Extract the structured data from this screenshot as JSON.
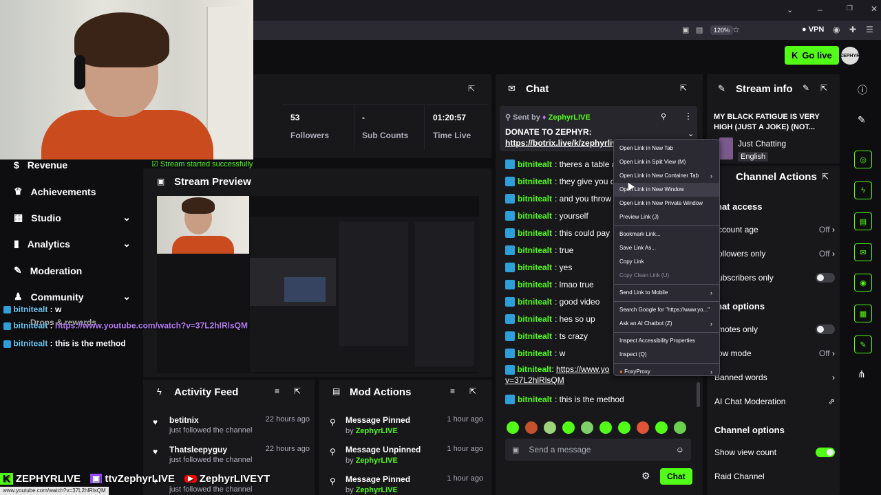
{
  "browser": {
    "zoom": "120%",
    "vpn_label": "VPN"
  },
  "header": {
    "go_live": "Go live",
    "avatar_text": "ZEPHYR"
  },
  "stats": {
    "followers_value": "53",
    "followers_label": "Followers",
    "subs_value": "-",
    "subs_label": "Sub Counts",
    "time_value": "01:20:57",
    "time_label": "Time Live"
  },
  "toast": "Stream started successfully",
  "sidebar": {
    "items": [
      {
        "label": "Revenue"
      },
      {
        "label": "Achievements"
      },
      {
        "label": "Studio"
      },
      {
        "label": "Analytics"
      },
      {
        "label": "Moderation"
      },
      {
        "label": "Community"
      },
      {
        "label": "Drops & rewards"
      }
    ]
  },
  "preview": {
    "title": "Stream Preview"
  },
  "overlay": {
    "chat": [
      {
        "user": "bitnitealt",
        "sep": " : ",
        "msg": "w"
      },
      {
        "user": "bitnitealt",
        "sep": " : ",
        "msg": "https://www.youtube.com/watch?v=37L2hlRlsQM"
      },
      {
        "user": "bitnitealt",
        "sep": " : ",
        "msg": "this is the method"
      }
    ],
    "banner": {
      "kick": "ZEPHYRLIVE",
      "twitch": "ttvZephyrLIVE",
      "youtube": "ZephyrLIVEYT"
    },
    "status_url": "www.youtube.com/watch?v=37L2hlRlsQM"
  },
  "chat": {
    "title": "Chat",
    "pinned": {
      "sent_by": "Sent by",
      "user": "ZephyrLIVE",
      "text": "DONATE TO ZEPHYR: ",
      "link": "https://botrix.live/k/zephyrlive/tip"
    },
    "messages": [
      {
        "user": "bitnitealt",
        "msg": ": theres a table a"
      },
      {
        "user": "bitnitealt",
        "msg": ": they give you d"
      },
      {
        "user": "bitnitealt",
        "msg": ": and you throw t"
      },
      {
        "user": "bitnitealt",
        "msg": ": yourself"
      },
      {
        "user": "bitnitealt",
        "msg": ": this could pay"
      },
      {
        "user": "bitnitealt",
        "msg": ": true"
      },
      {
        "user": "bitnitealt",
        "msg": ": yes"
      },
      {
        "user": "bitnitealt",
        "msg": ": lmao true"
      },
      {
        "user": "bitnitealt",
        "msg": ": good video"
      },
      {
        "user": "bitnitealt",
        "msg": ": hes so up"
      },
      {
        "user": "bitnitealt",
        "msg": ": ts crazy"
      },
      {
        "user": "bitnitealt",
        "msg": ": w"
      }
    ],
    "link_msg": {
      "user": "bitnitealt",
      "sep": ": ",
      "link": "https://www.yo",
      "link2": "v=37L2hlRlsQM"
    },
    "last_msg": {
      "user": "bitnitealt",
      "msg": ": this is the method"
    },
    "input_placeholder": "Send a message",
    "send_label": "Chat"
  },
  "context_menu": {
    "items": [
      {
        "label": "Open Link in New Tab",
        "arrow": ""
      },
      {
        "label": "Open Link in Split View (M)",
        "arrow": ""
      },
      {
        "label": "Open Link in New Container Tab",
        "arrow": "›"
      },
      {
        "label": "Open Link in New Window",
        "arrow": ""
      },
      {
        "label": "Open Link in New Private Window",
        "arrow": ""
      },
      {
        "label": "Preview Link (J)",
        "arrow": ""
      },
      {
        "label": "Bookmark Link...",
        "arrow": ""
      },
      {
        "label": "Save Link As...",
        "arrow": ""
      },
      {
        "label": "Copy Link",
        "arrow": ""
      },
      {
        "label": "Copy Clean Link (U)",
        "arrow": ""
      },
      {
        "label": "Send Link to Mobile",
        "arrow": "›"
      },
      {
        "label": "Search Google for \"https://www.yo...\"",
        "arrow": ""
      },
      {
        "label": "Ask an AI Chatbot (Z)",
        "arrow": "›"
      },
      {
        "label": "Inspect Accessibility Properties",
        "arrow": ""
      },
      {
        "label": "Inspect (Q)",
        "arrow": ""
      },
      {
        "label": "FoxyProxy",
        "arrow": "›"
      }
    ]
  },
  "stream_info": {
    "title": "Stream info",
    "stream_title": "MY BLACK FATIGUE IS VERY HIGH (JUST A JOKE) (NOT...",
    "category": "Just Chatting",
    "language": "English"
  },
  "channel_actions": {
    "title": "Channel Actions",
    "chat_access": "hat access",
    "account_age": "ccount age",
    "account_age_val": "Off",
    "followers_only": "ollowers only",
    "followers_only_val": "Off",
    "subscribers_only": "ubscribers only",
    "chat_options": "hat options",
    "emotes_only": "motes only",
    "slow_mode": "ow mode",
    "slow_mode_val": "Off",
    "banned_words": "Banned words",
    "ai_moderation": "AI Chat Moderation",
    "channel_options": "Channel options",
    "show_view_count": "Show view count",
    "raid_channel": "Raid Channel"
  },
  "activity": {
    "title": "Activity Feed",
    "rows": [
      {
        "name": "betitnix",
        "sub": "just followed the channel",
        "time": "22 hours ago"
      },
      {
        "name": "Thatsleepyguy",
        "sub": "just followed the channel",
        "time": "22 hours ago"
      },
      {
        "name": "",
        "sub": "just followed the channel",
        "time": ""
      }
    ]
  },
  "mod_actions": {
    "title": "Mod Actions",
    "rows": [
      {
        "action": "Message Pinned",
        "by": "by ",
        "user": "ZephyrLIVE",
        "time": "1 hour ago"
      },
      {
        "action": "Message Unpinned",
        "by": "by ",
        "user": "ZephyrLIVE",
        "time": "1 hour ago"
      },
      {
        "action": "Message Pinned",
        "by": "by ",
        "user": "ZephyrLIVE",
        "time": "1 hour ago"
      }
    ]
  },
  "colors": {
    "accent": "#53fc18",
    "panel": "#18181b",
    "bg": "#0e0e10"
  }
}
